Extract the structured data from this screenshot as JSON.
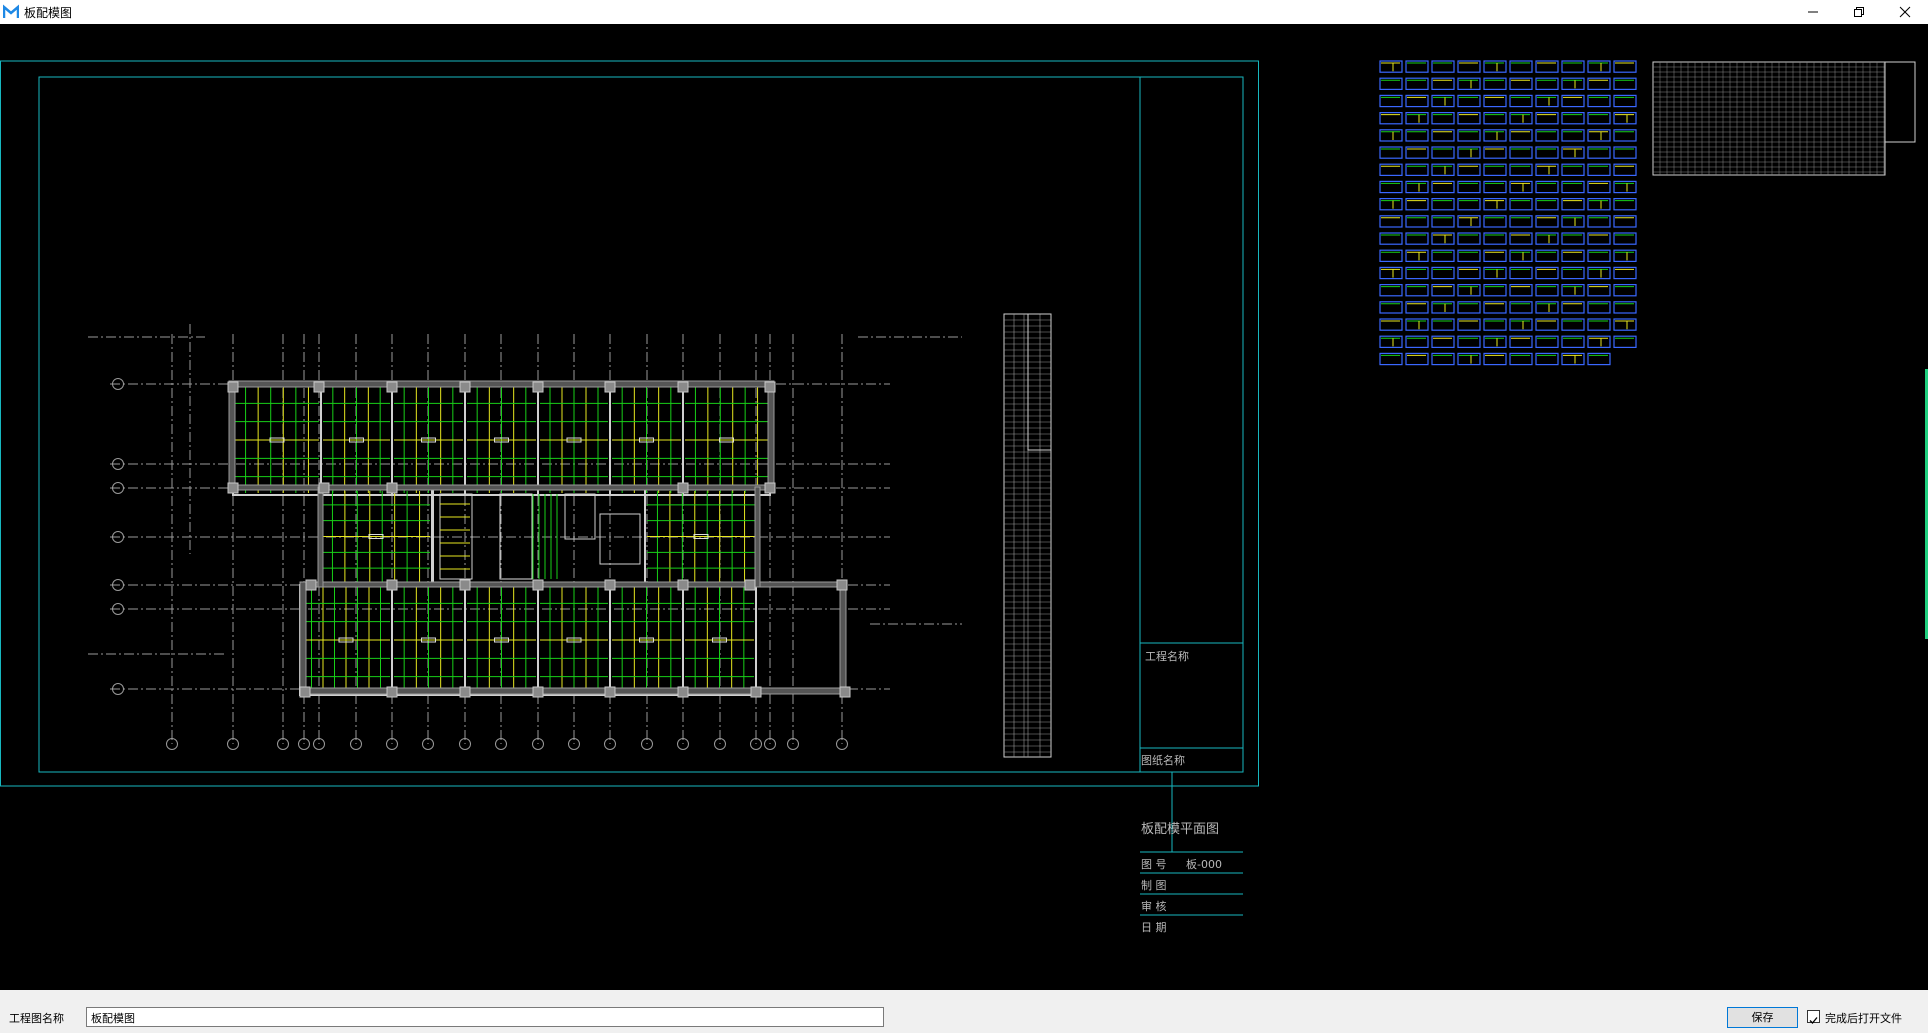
{
  "window": {
    "title": "板配模图",
    "minimize_icon": "minimize-icon",
    "restore_icon": "restore-icon",
    "close_icon": "close-icon"
  },
  "drawing": {
    "title_block": {
      "project_name_label": "工程名称",
      "drawing_name_label": "图纸名称",
      "drawing_name_value": "板配模平面图",
      "drawing_no_label": "图  号",
      "drawing_no_value": "板-000",
      "drafter_label": "制  图",
      "reviewer_label": "审  核",
      "date_label": "日  期"
    },
    "colors": {
      "frame": "#17b7bf",
      "structure": "#d0d0d0",
      "panel_green": "#18d018",
      "panel_yellow": "#e8e820",
      "panel_blue": "#3a68ff",
      "axis": "#9a9a9a"
    }
  },
  "footer": {
    "project_drawing_name_label": "工程图名称",
    "project_drawing_name_value": "板配模图",
    "save_button": "保存",
    "open_after_label": "完成后打开文件",
    "open_after_checked": true
  }
}
